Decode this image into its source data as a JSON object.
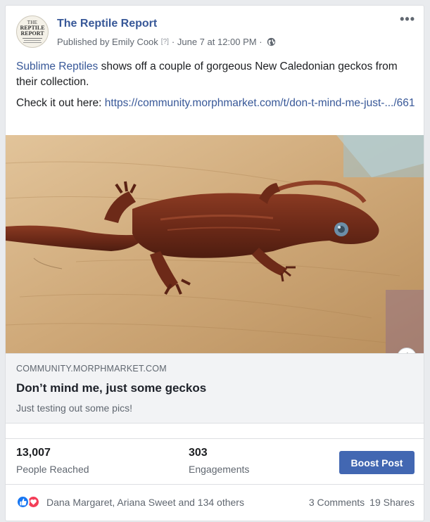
{
  "post": {
    "page_name": "The Reptile Report",
    "avatar_text": [
      "THE",
      "REPTILE",
      "REPORT"
    ],
    "published_by": "Published by Emily Cook",
    "help_marker": "[?]",
    "date": "· June 7 at 12:00 PM ·",
    "body_mention": "Sublime Reptiles",
    "body_line1_rest": " shows off a couple of gorgeous New Caledonian geckos from their collection.",
    "body_line2_prefix": "Check it out here: ",
    "body_link": "https://community.morphmarket.com/t/don-t-mind-me-just-.../661",
    "info_glyph": "i",
    "more_glyph": "•••"
  },
  "preview": {
    "domain": "COMMUNITY.MORPHMARKET.COM",
    "title": "Don’t mind me, just some geckos",
    "description": "Just testing out some pics!"
  },
  "stats": {
    "reached_value": "13,007",
    "reached_label": "People Reached",
    "engagements_value": "303",
    "engagements_label": "Engagements",
    "boost_label": "Boost Post"
  },
  "reactions": {
    "names": "Dana Margaret, Ariana Sweet and 134 others",
    "comments": "3 Comments",
    "shares": "19 Shares"
  },
  "colors": {
    "link": "#385898",
    "boost": "#4267b2",
    "like": "#1877f2",
    "love": "#f33e58"
  }
}
